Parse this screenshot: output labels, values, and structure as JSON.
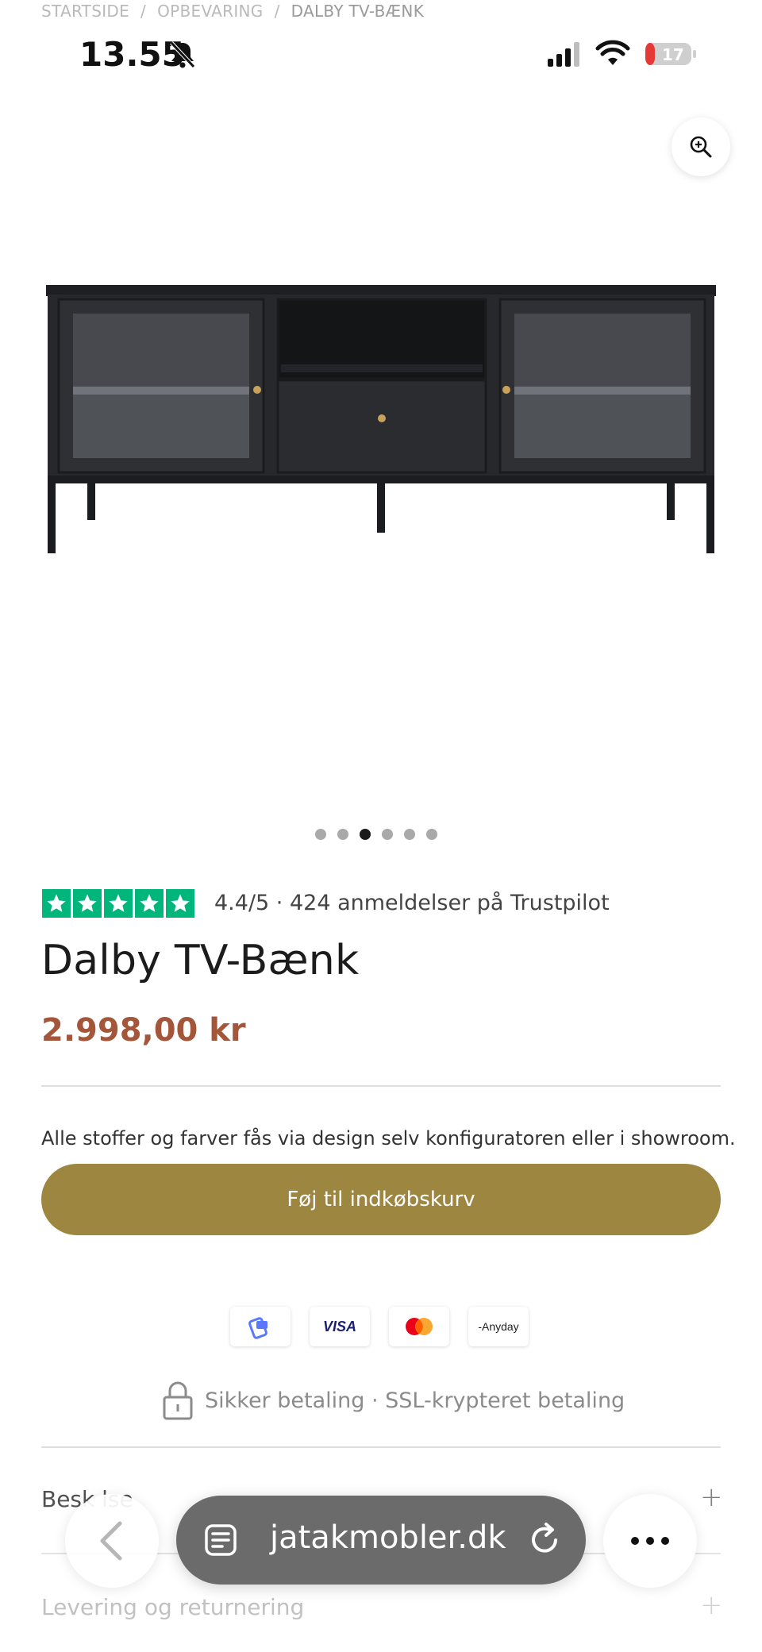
{
  "breadcrumb": [
    "STARTSIDE",
    "OPBEVARING",
    "DALBY TV-BÆNK"
  ],
  "breadcrumb_separator": "/",
  "status_bar": {
    "time": "13.55",
    "battery": "17"
  },
  "gallery": {
    "image_count": 6,
    "active_index": 2,
    "zoom_icon": "zoom-in-icon"
  },
  "trustpilot": {
    "stars": 5,
    "text": "4.4/5 · 424 anmeldelser på Trustpilot",
    "color": "#00b67a"
  },
  "product": {
    "title": "Dalby TV-Bænk",
    "price": "2.998,00 kr",
    "note": "Alle stoffer og farver fås via design selv konfiguratoren eller i showroom.",
    "add_to_cart": "Føj til indkøbskurv"
  },
  "payments": {
    "visa": "VISA",
    "anyday": "-Anyday",
    "icons": [
      "mobilepay-icon",
      "visa-icon",
      "mastercard-icon",
      "anyday-icon"
    ]
  },
  "secure_payment": "Sikker betaling · SSL-krypteret betaling",
  "accordion": [
    {
      "label": "Beskrivelse",
      "visible_label": "Besk  lse",
      "icon": "+"
    },
    {
      "label": "Levering og returnering",
      "icon": "+"
    }
  ],
  "browser": {
    "url": "jatakmobler.dk"
  },
  "colors": {
    "accent": "#9d8640",
    "price": "#a4563a"
  }
}
